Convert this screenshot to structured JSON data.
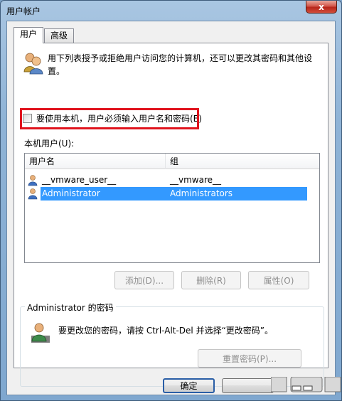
{
  "window": {
    "title": "用户帐户",
    "close_glyph": "x"
  },
  "tabs": [
    {
      "label": "用户",
      "active": true
    },
    {
      "label": "高级",
      "active": false
    }
  ],
  "description": "用下列表授予或拒绝用户访问您的计算机，还可以更改其密码和其他设置。",
  "require_password_checkbox": {
    "label": "要使用本机，用户必须输入用户名和密码(E)",
    "checked": false
  },
  "local_users_label": "本机用户(U):",
  "user_list": {
    "columns": [
      "用户名",
      "组"
    ],
    "rows": [
      {
        "name": "__vmware_user__",
        "group": "__vmware__",
        "selected": false
      },
      {
        "name": "Administrator",
        "group": "Administrators",
        "selected": true
      }
    ]
  },
  "list_buttons": {
    "add": "添加(D)...",
    "remove": "删除(R)",
    "properties": "属性(O)"
  },
  "password_group": {
    "title": "Administrator 的密码",
    "text": "要更改您的密码，请按 Ctrl-Alt-Del 并选择“更改密码”。",
    "reset_button": "重置密码(P)..."
  },
  "footer": {
    "ok": "确定"
  },
  "colors": {
    "selection": "#3399ff",
    "highlight_border": "#e0141e"
  }
}
